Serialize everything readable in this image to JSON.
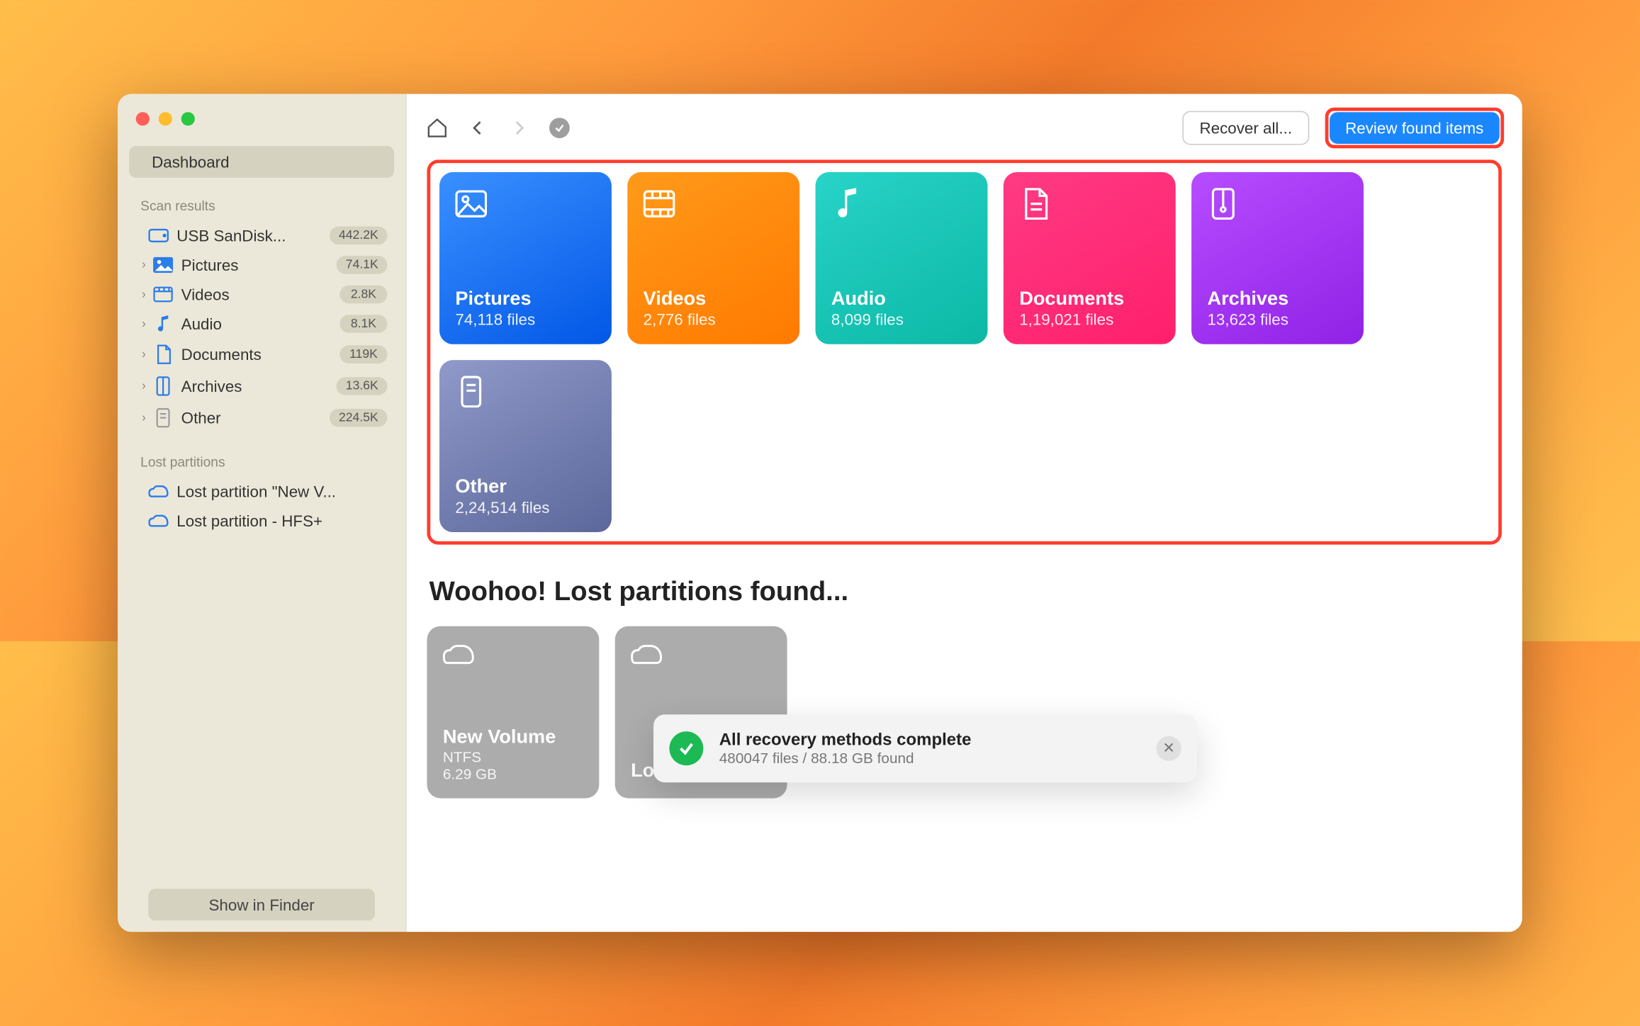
{
  "sidebar": {
    "dashboard_label": "Dashboard",
    "scan_results_label": "Scan results",
    "device": {
      "label": "USB  SanDisk...",
      "count": "442.2K"
    },
    "items": [
      {
        "label": "Pictures",
        "count": "74.1K"
      },
      {
        "label": "Videos",
        "count": "2.8K"
      },
      {
        "label": "Audio",
        "count": "8.1K"
      },
      {
        "label": "Documents",
        "count": "119K"
      },
      {
        "label": "Archives",
        "count": "13.6K"
      },
      {
        "label": "Other",
        "count": "224.5K"
      }
    ],
    "lost_label": "Lost partitions",
    "lost": [
      {
        "label": "Lost partition \"New V..."
      },
      {
        "label": "Lost partition - HFS+"
      }
    ],
    "show_in_finder": "Show in Finder"
  },
  "toolbar": {
    "recover_all": "Recover all...",
    "review": "Review found items"
  },
  "cards": {
    "pictures": {
      "title": "Pictures",
      "sub": "74,118 files"
    },
    "videos": {
      "title": "Videos",
      "sub": "2,776 files"
    },
    "audio": {
      "title": "Audio",
      "sub": "8,099 files"
    },
    "documents": {
      "title": "Documents",
      "sub": "1,19,021 files"
    },
    "archives": {
      "title": "Archives",
      "sub": "13,623 files"
    },
    "other": {
      "title": "Other",
      "sub": "2,24,514 files"
    }
  },
  "partitions_heading": "Woohoo! Lost partitions found...",
  "partitions": [
    {
      "title": "New Volume",
      "fs": "NTFS",
      "size": "6.29 GB"
    },
    {
      "title": "Lost partiti...",
      "fs": "",
      "size": ""
    }
  ],
  "toast": {
    "title": "All recovery methods complete",
    "sub": "480047 files / 88.18 GB found"
  }
}
